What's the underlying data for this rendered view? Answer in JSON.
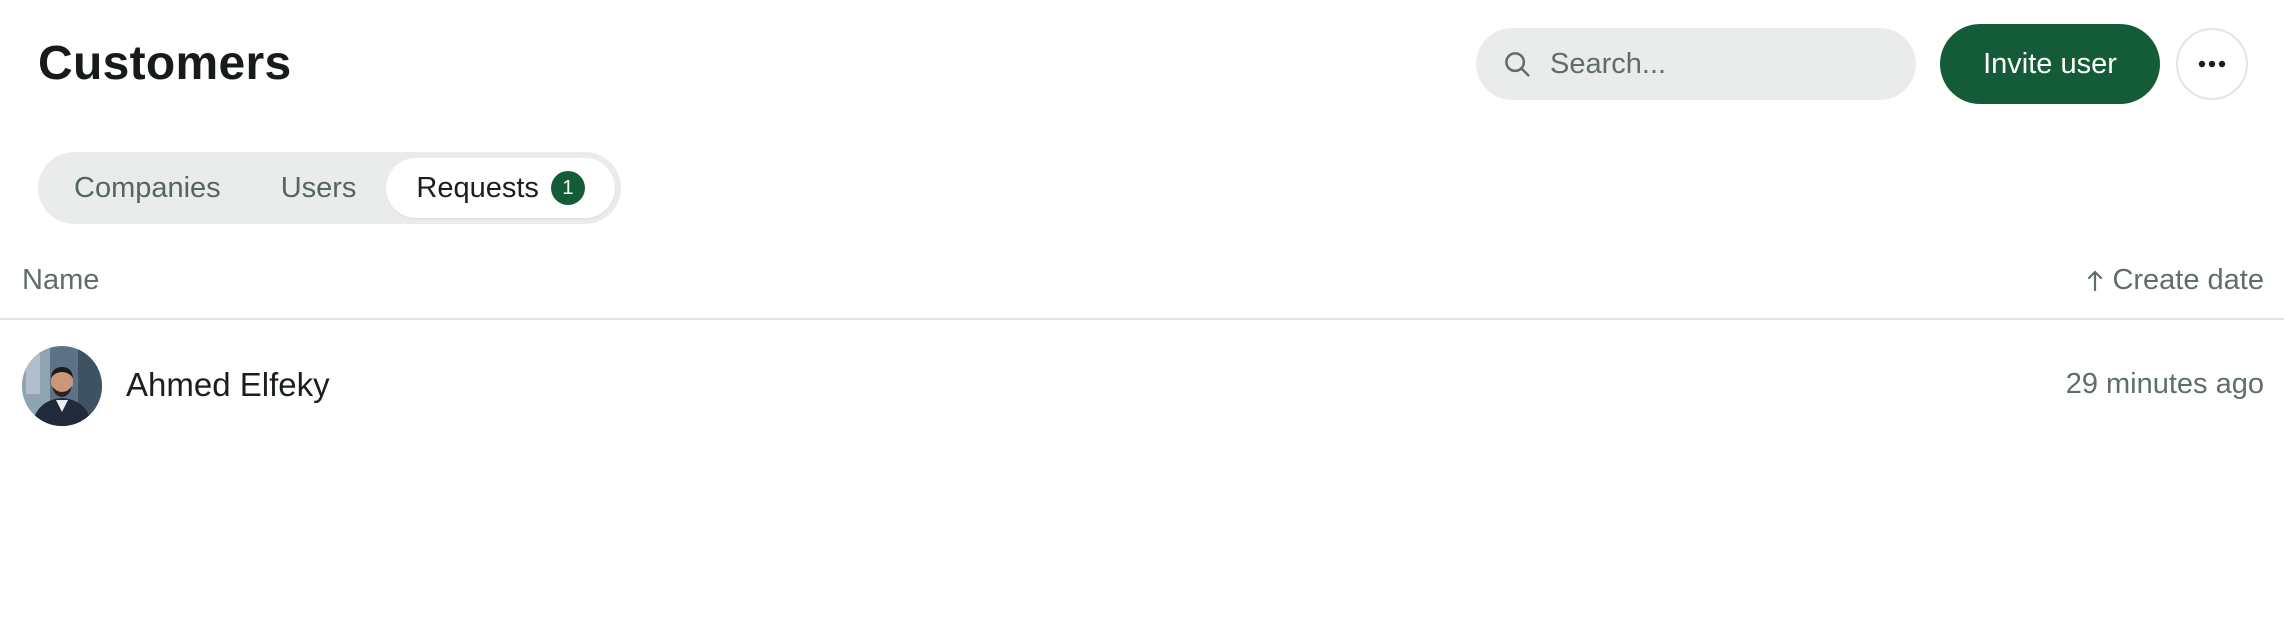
{
  "header": {
    "title": "Customers",
    "search_placeholder": "Search...",
    "search_value": "",
    "invite_label": "Invite user"
  },
  "tabs": [
    {
      "label": "Companies",
      "active": false
    },
    {
      "label": "Users",
      "active": false
    },
    {
      "label": "Requests",
      "active": true,
      "badge": "1"
    }
  ],
  "table": {
    "columns": {
      "name": "Name",
      "date": "Create date"
    },
    "sort_direction": "ascending",
    "rows": [
      {
        "name": "Ahmed Elfeky",
        "created": "29 minutes ago"
      }
    ]
  },
  "colors": {
    "accent": "#145c37",
    "surface": "#e9ecea",
    "muted_text": "#5f6f67"
  },
  "icons": {
    "search": "search-icon",
    "more": "more-horizontal-icon",
    "sort": "arrow-up-icon"
  }
}
